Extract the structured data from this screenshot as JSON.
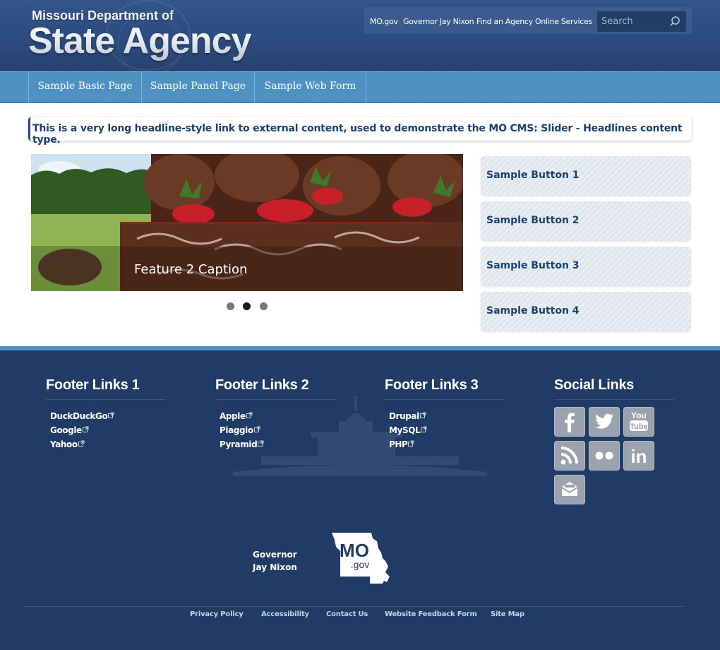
{
  "header": {
    "logo_sub": "Missouri Department of",
    "logo_main": "State Agency",
    "links": [
      "MO.gov",
      "Governor Jay Nixon",
      "Find an Agency",
      "Online Services"
    ],
    "search_placeholder": "Search"
  },
  "nav": {
    "items": [
      "Sample Basic Page",
      "Sample Panel Page",
      "Sample Web Form"
    ]
  },
  "headline": {
    "text": "This is a very long headline-style link to external content, used to demonstrate the MO CMS: Slider - Headlines content type."
  },
  "slider": {
    "caption": "Feature 2 Caption",
    "slide_count": 3,
    "active_slide": 2
  },
  "buttons": [
    "Sample Button 1",
    "Sample Button 2",
    "Sample Button 3",
    "Sample Button 4"
  ],
  "footer": {
    "columns": [
      {
        "title": "Footer Links 1",
        "links": [
          "DuckDuckGo",
          "Google",
          "Yahoo"
        ]
      },
      {
        "title": "Footer Links 2",
        "links": [
          "Apple",
          "Piaggio",
          "Pyramid"
        ]
      },
      {
        "title": "Footer Links 3",
        "links": [
          "Drupal",
          "MySQL",
          "PHP"
        ]
      }
    ],
    "social_title": "Social Links",
    "social_icons": [
      "facebook-icon",
      "twitter-icon",
      "youtube-icon",
      "rss-icon",
      "flickr-icon",
      "linkedin-icon",
      "email-icon"
    ],
    "youtube_label_top": "You",
    "youtube_label_bottom": "Tube",
    "linkedin_label": "in",
    "governor_line1": "Governor",
    "governor_line2": "Jay Nixon",
    "mo_logo_text": "MO",
    "mo_logo_sub": ".gov",
    "legal_links": [
      "Privacy Policy",
      "Accessibility",
      "Contact Us",
      "Website Feedback Form",
      "Site Map"
    ]
  },
  "colors": {
    "header_bg": "#2c4b7e",
    "nav_bg": "#4f91c2",
    "footer_bg": "#1f3b66",
    "link_dark": "#1d416f"
  }
}
